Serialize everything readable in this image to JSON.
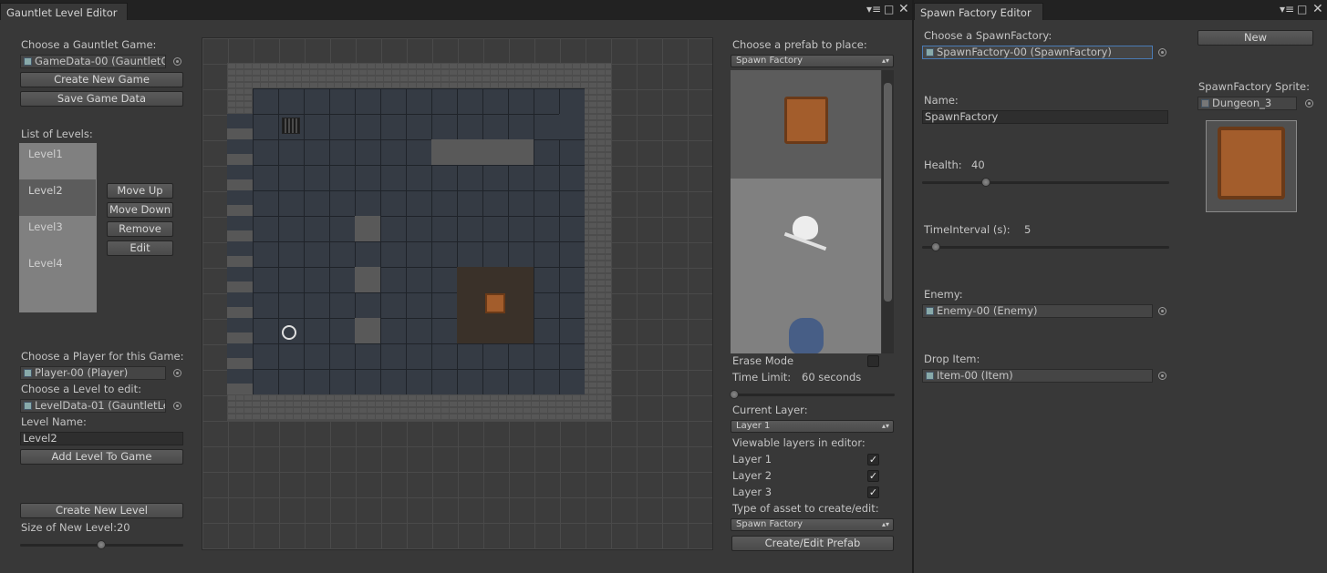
{
  "level_editor": {
    "title": "Gauntlet Level Editor",
    "choose_game_label": "Choose a Gauntlet Game:",
    "game_field": "GameData-00 (GauntletG",
    "create_new_game": "Create New Game",
    "save_game_data": "Save Game Data",
    "list_of_levels_label": "List of Levels:",
    "levels": [
      "Level1",
      "Level2",
      "Level3",
      "Level4"
    ],
    "selected_level": "Level2",
    "move_up": "Move Up",
    "move_down": "Move Down",
    "remove": "Remove",
    "edit": "Edit",
    "choose_player_label": "Choose a Player for this Game:",
    "player_field": "Player-00 (Player)",
    "choose_level_label": "Choose a Level to edit:",
    "level_field": "LevelData-01 (GauntletLe",
    "level_name_label": "Level Name:",
    "level_name_value": "Level2",
    "add_level": "Add Level To Game",
    "create_new_level": "Create New Level",
    "size_label": "Size of New Level:20",
    "size_value": 20
  },
  "prefab_panel": {
    "choose_prefab_label": "Choose a prefab to place:",
    "prefab_dropdown": "Spawn Factory",
    "erase_mode_label": "Erase Mode",
    "time_limit_label": "Time Limit:",
    "time_limit_value": "60 seconds",
    "current_layer_label": "Current Layer:",
    "current_layer_value": "Layer 1",
    "viewable_label": "Viewable layers in editor:",
    "layers": [
      "Layer 1",
      "Layer 2",
      "Layer 3"
    ],
    "asset_type_label": "Type of asset to create/edit:",
    "asset_type_value": "Spawn Factory",
    "create_edit_prefab": "Create/Edit Prefab"
  },
  "spawn_editor": {
    "title": "Spawn Factory Editor",
    "choose_label": "Choose a SpawnFactory:",
    "factory_field": "SpawnFactory-00 (SpawnFactory)",
    "new_button": "New",
    "sprite_label": "SpawnFactory Sprite:",
    "sprite_field": "Dungeon_3",
    "name_label": "Name:",
    "name_value": "SpawnFactory",
    "health_label": "Health:",
    "health_value": "40",
    "interval_label": "TimeInterval (s):",
    "interval_value": "5",
    "enemy_label": "Enemy:",
    "enemy_field": "Enemy-00 (Enemy)",
    "drop_label": "Drop Item:",
    "drop_field": "Item-00 (Item)"
  },
  "colors": {
    "background": "#383838",
    "tab_bar": "#222222",
    "floor_tile": "#3a4048",
    "wall": "#595959",
    "selected_field_border": "#4a7bb5"
  },
  "icons": [
    "gear-icon",
    "maximize-icon",
    "close-icon",
    "object-picker-icon",
    "crate-icon",
    "skull-icon",
    "pot-icon",
    "grate-icon",
    "spawn-point-icon"
  ]
}
